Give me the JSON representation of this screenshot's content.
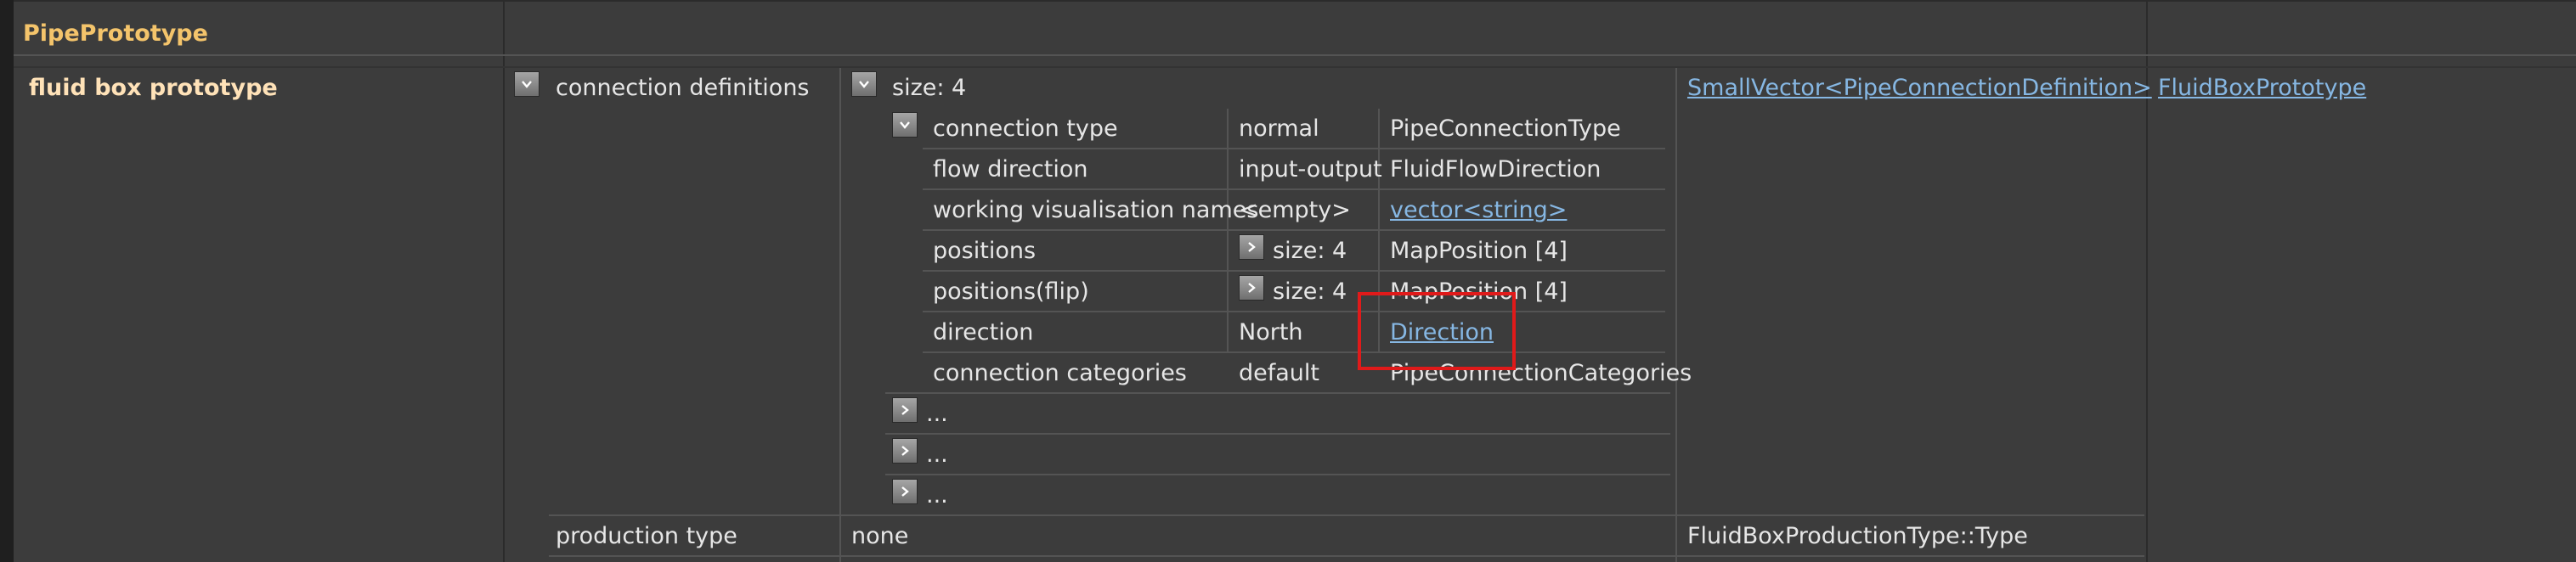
{
  "header": {
    "title": "PipePrototype"
  },
  "row": {
    "label": "fluid box prototype",
    "type_link": "FluidBoxPrototype",
    "connection_definitions": {
      "label": "connection definitions",
      "size": "size: 4",
      "type_link": "SmallVector<PipeConnectionDefinition>",
      "item": [
        {
          "name": "connection type",
          "value": "normal",
          "type": "PipeConnectionType"
        },
        {
          "name": "flow direction",
          "value": "input-output",
          "type": "FluidFlowDirection"
        },
        {
          "name": "working visualisation names",
          "value": "<empty>",
          "type": "vector<string>"
        },
        {
          "name": "positions",
          "value": "size: 4",
          "type": "MapPosition [4]"
        },
        {
          "name": "positions(flip)",
          "value": "size: 4",
          "type": "MapPosition [4]"
        },
        {
          "name": "direction",
          "value": "North",
          "type": "Direction"
        },
        {
          "name": "connection categories",
          "value": "default",
          "type": "PipeConnectionCategories"
        }
      ],
      "collapsed": [
        "...",
        "...",
        "..."
      ]
    },
    "production_type": {
      "label": "production type",
      "value": "none",
      "type": "FluidBoxProductionType::Type"
    }
  }
}
